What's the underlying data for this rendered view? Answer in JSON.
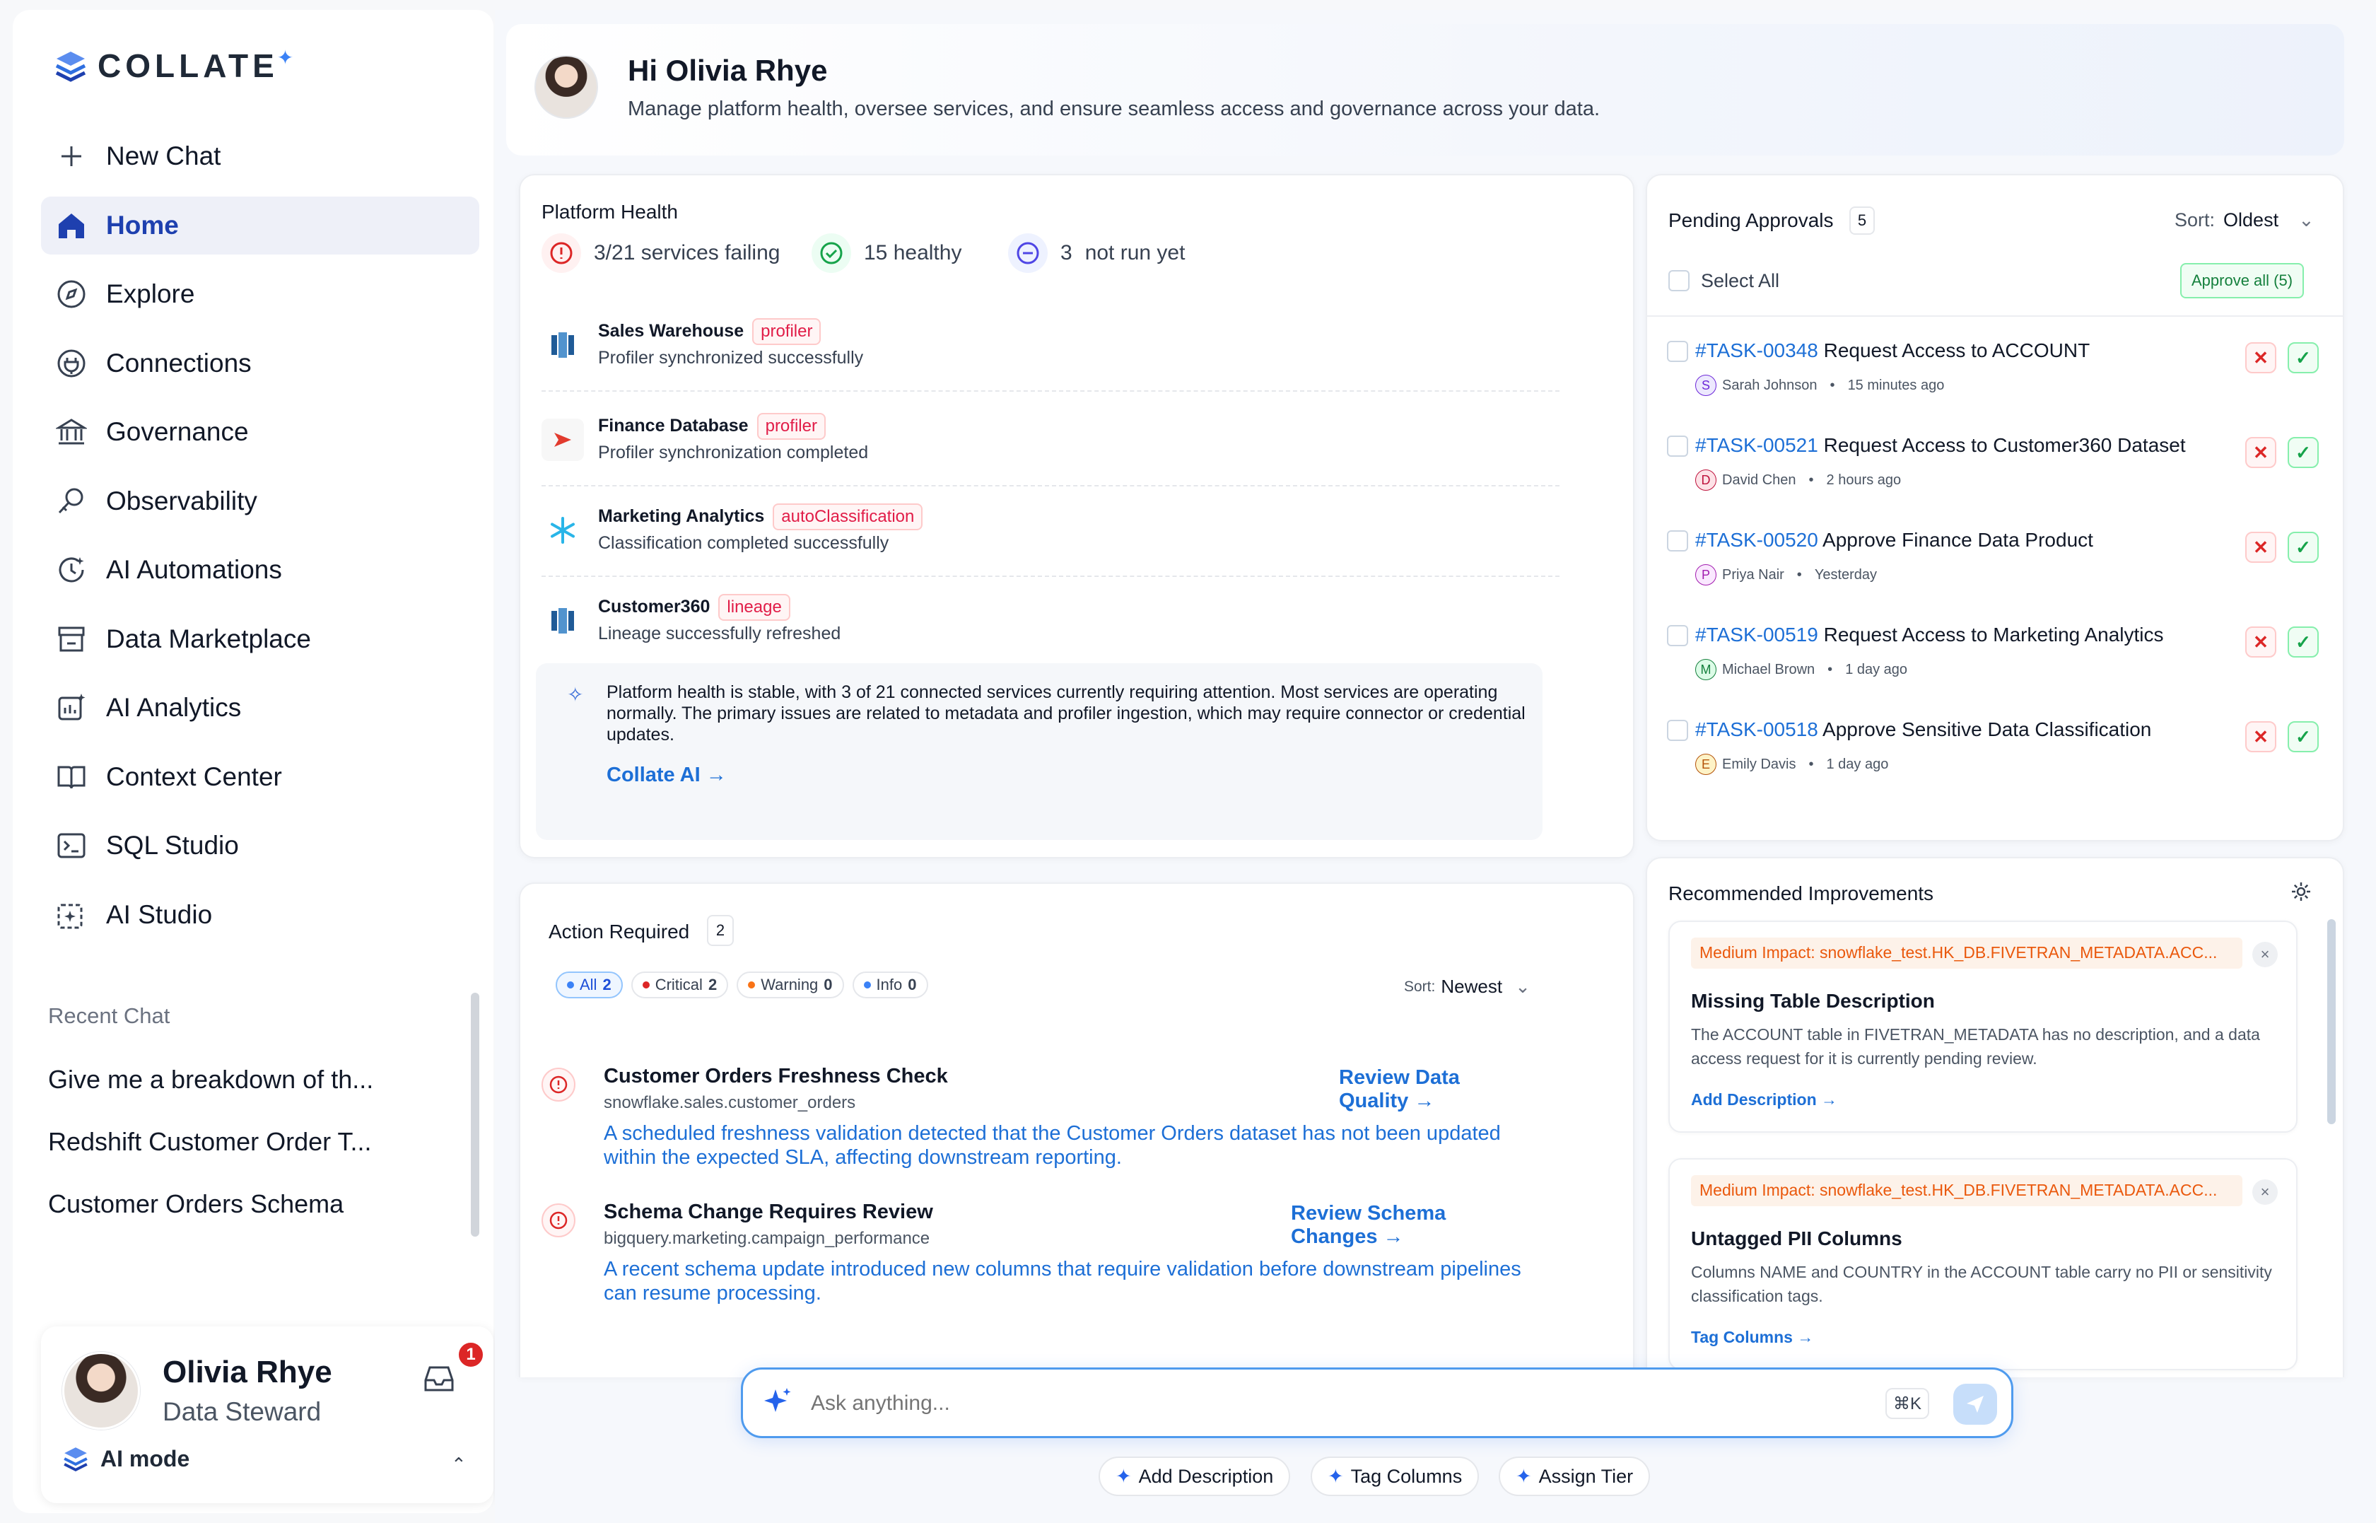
{
  "app": {
    "logo_text": "COLLATE"
  },
  "sidebar": {
    "new_chat": "New Chat",
    "items": [
      {
        "label": "Home",
        "icon": "home-icon"
      },
      {
        "label": "Explore",
        "icon": "compass-icon"
      },
      {
        "label": "Connections",
        "icon": "plug-icon"
      },
      {
        "label": "Governance",
        "icon": "bank-icon"
      },
      {
        "label": "Observability",
        "icon": "telescope-icon"
      },
      {
        "label": "AI Automations",
        "icon": "automation-icon"
      },
      {
        "label": "Data Marketplace",
        "icon": "storefront-icon"
      },
      {
        "label": "AI Analytics",
        "icon": "analytics-icon"
      },
      {
        "label": "Context Center",
        "icon": "book-icon"
      },
      {
        "label": "SQL Studio",
        "icon": "terminal-icon"
      },
      {
        "label": "AI Studio",
        "icon": "ai-studio-icon"
      }
    ],
    "recent_heading": "Recent Chat",
    "recent": [
      "Give me a breakdown of th...",
      "Redshift Customer Order T...",
      "Customer Orders Schema"
    ]
  },
  "user": {
    "name": "Olivia Rhye",
    "role": "Data Steward",
    "notifications": "1",
    "mode": "AI mode"
  },
  "header": {
    "greeting": "Hi Olivia Rhye",
    "subtitle": "Manage platform health, oversee services, and ensure seamless access and governance across your data."
  },
  "platform_health": {
    "title": "Platform Health",
    "stats": {
      "failing": "3/21 services failing",
      "healthy": "15 healthy",
      "not_run_count": "3",
      "not_run": "not run yet"
    },
    "services": [
      {
        "name": "Sales Warehouse",
        "tag": "profiler",
        "message": "Profiler synchronized successfully"
      },
      {
        "name": "Finance Database",
        "tag": "profiler",
        "message": "Profiler synchronization completed"
      },
      {
        "name": "Marketing Analytics",
        "tag": "autoClassification",
        "message": "Classification completed successfully"
      },
      {
        "name": "Customer360",
        "tag": "lineage",
        "message": "Lineage successfully refreshed"
      }
    ],
    "ai_summary": "Platform health is stable, with 3 of 21 connected services currently requiring attention. Most services are operating normally. The primary issues are related to metadata and profiler ingestion, which may require connector or credential updates.",
    "ai_link": "Collate AI →"
  },
  "action_required": {
    "title": "Action Required",
    "count": "2",
    "filters": [
      {
        "label": "All",
        "count": "2"
      },
      {
        "label": "Critical",
        "count": "2"
      },
      {
        "label": "Warning",
        "count": "0"
      },
      {
        "label": "Info",
        "count": "0"
      }
    ],
    "sort_label": "Sort:",
    "sort_value": "Newest",
    "items": [
      {
        "title": "Customer Orders Freshness Check",
        "source": "snowflake.sales.customer_orders",
        "description": "A scheduled freshness validation detected that the Customer Orders dataset has not been updated within the expected SLA, affecting downstream reporting.",
        "link": "Review Data Quality →"
      },
      {
        "title": "Schema Change Requires Review",
        "source": "bigquery.marketing.campaign_performance",
        "description": "A recent schema update introduced new columns that require validation before downstream pipelines can resume processing.",
        "link": "Review Schema Changes →"
      }
    ]
  },
  "pending_approvals": {
    "title": "Pending Approvals",
    "count": "5",
    "sort_label": "Sort:",
    "sort_value": "Oldest",
    "select_all": "Select All",
    "approve_all": "Approve all (5)",
    "items": [
      {
        "id": "#TASK-00348",
        "title": "Request Access to ACCOUNT",
        "initial": "S",
        "user": "Sarah Johnson",
        "time": "15 minutes ago"
      },
      {
        "id": "#TASK-00521",
        "title": "Request Access to Customer360 Dataset",
        "initial": "D",
        "user": "David Chen",
        "time": "2 hours ago"
      },
      {
        "id": "#TASK-00520",
        "title": "Approve Finance Data Product",
        "initial": "P",
        "user": "Priya Nair",
        "time": "Yesterday"
      },
      {
        "id": "#TASK-00519",
        "title": "Request Access to Marketing Analytics",
        "initial": "M",
        "user": "Michael Brown",
        "time": "1 day ago"
      },
      {
        "id": "#TASK-00518",
        "title": "Approve Sensitive Data Classification",
        "initial": "E",
        "user": "Emily Davis",
        "time": "1 day ago"
      }
    ]
  },
  "recommended": {
    "title": "Recommended Improvements",
    "items": [
      {
        "impact": "Medium Impact: snowflake_test.HK_DB.FIVETRAN_METADATA.ACC...",
        "title": "Missing Table Description",
        "description": "The ACCOUNT table in FIVETRAN_METADATA has no description, and a data access request for it is currently pending review.",
        "link": "Add Description →"
      },
      {
        "impact": "Medium Impact: snowflake_test.HK_DB.FIVETRAN_METADATA.ACC...",
        "title": "Untagged PII Columns",
        "description": "Columns NAME and COUNTRY in the ACCOUNT table carry no PII or sensitivity classification tags.",
        "link": "Tag Columns →"
      }
    ]
  },
  "ask": {
    "placeholder": "Ask anything...",
    "shortcut": "⌘K"
  },
  "quick_actions": [
    "Add Description",
    "Tag Columns",
    "Assign Tier"
  ],
  "colors": {
    "primary": "#1d6fd6",
    "danger": "#dc2626",
    "success": "#16a34a",
    "warning": "#f97316"
  }
}
